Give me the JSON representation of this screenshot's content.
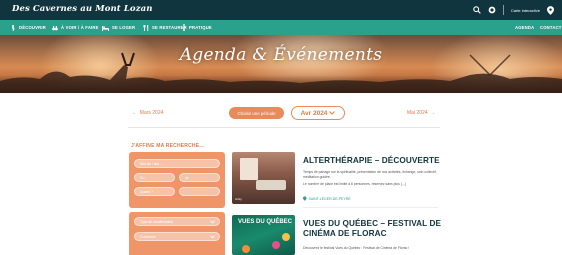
{
  "topbar": {
    "logo_main": "Des Cavernes au Mont Lozan",
    "logo_small": "au",
    "contact_label": "Carte interactive"
  },
  "nav": {
    "items": [
      {
        "label": "DÉCOUVRIR",
        "icon": "hiker-icon"
      },
      {
        "label": "À VOIR / À FAIRE",
        "icon": "binoculars-icon"
      },
      {
        "label": "SE LOGER",
        "icon": "bed-icon"
      },
      {
        "label": "SE RESTAURER",
        "icon": "cutlery-icon"
      },
      {
        "label": "PRATIQUE",
        "icon": "info-icon"
      }
    ],
    "right": [
      "AGENDA",
      "CONTACT"
    ]
  },
  "hero": {
    "title": "Agenda & Événements"
  },
  "month_nav": {
    "prev": "Mars 2024",
    "choose": "Choisir une période",
    "current": "Avr 2024",
    "next": "Mai 2024"
  },
  "filters": {
    "title": "J'AFFINE MA RECHERCHE...",
    "fields": [
      "Mot-clé / lieu...",
      "Du",
      "Au",
      "Quand ?",
      "Type de manifestation",
      "Commune"
    ]
  },
  "events": [
    {
      "title": "ALTERTHÉRAPIE – DÉCOUVERTE",
      "desc1": "Temps de partage sur la spiritualité, présentation de nos activités, échange, soin collectif, méditation guidée.",
      "desc2": "Le nombre de place est limité à 6 personnes, réservez sans plus [...]",
      "location": "SAINT-LÉGER-DE-PEYRE",
      "img_label": "Artsy"
    },
    {
      "title": "VUES DU QUÉBEC – FESTIVAL DE CINÉMA DE FLORAC",
      "desc1": "Découvrez le festival Vues du Québec : Festival de Cinéma de Florac !",
      "img_label": "VUES DU QUÉBEC"
    }
  ]
}
